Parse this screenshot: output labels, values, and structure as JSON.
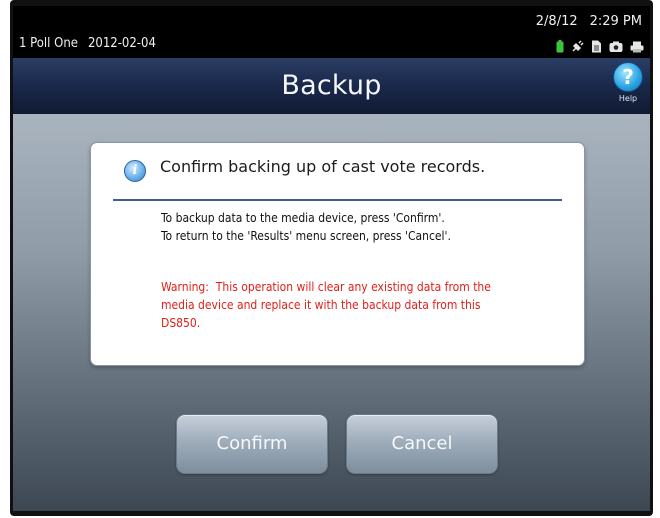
{
  "status_bar": {
    "poll_name": "1 Poll One",
    "poll_date": "2012-02-04",
    "date": "2/8/12",
    "time": "2:29 PM",
    "icons": [
      "battery-icon",
      "power-plug-icon",
      "document-icon",
      "camera-icon",
      "printer-icon"
    ]
  },
  "header": {
    "title": "Backup",
    "help_label": "Help",
    "help_glyph": "?"
  },
  "dialog": {
    "info_glyph": "i",
    "heading": "Confirm backing up of cast vote records.",
    "lines": [
      "To backup data to the media device, press 'Confirm'.",
      "To return to the 'Results' menu screen, press 'Cancel'."
    ],
    "warning_lines": [
      "Warning:  This operation will clear any existing data from the",
      "media device and replace it with the backup data from this",
      "DS850."
    ]
  },
  "buttons": {
    "confirm_label": "Confirm",
    "cancel_label": "Cancel"
  },
  "colors": {
    "title_bar": "#1b2a4d",
    "warning_text": "#e0211b",
    "battery": "#3cc43c",
    "rule": "#3b5f92"
  }
}
